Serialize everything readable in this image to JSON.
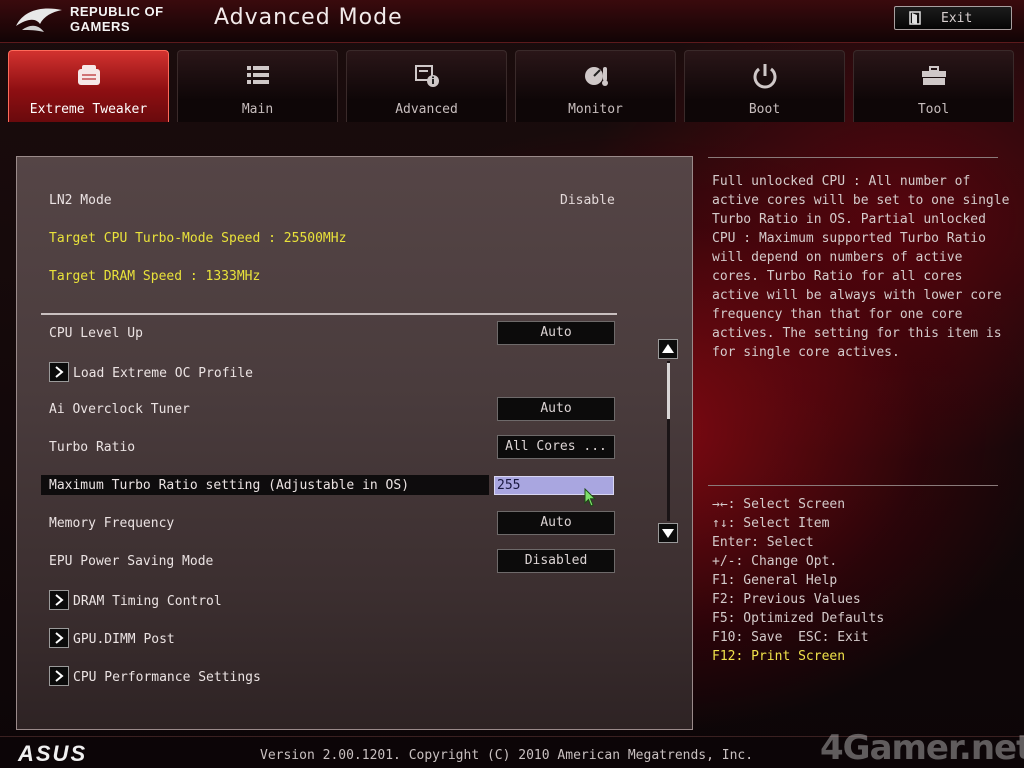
{
  "header": {
    "brand_line1": "REPUBLIC OF",
    "brand_line2": "GAMERS",
    "title": "Advanced Mode",
    "exit_label": "Exit"
  },
  "tabs": [
    {
      "label": "Extreme Tweaker",
      "icon": "tweaker-icon",
      "active": true
    },
    {
      "label": "Main",
      "icon": "list-icon",
      "active": false
    },
    {
      "label": "Advanced",
      "icon": "advanced-icon",
      "active": false
    },
    {
      "label": "Monitor",
      "icon": "monitor-gauge-icon",
      "active": false
    },
    {
      "label": "Boot",
      "icon": "power-icon",
      "active": false
    },
    {
      "label": "Tool",
      "icon": "toolbox-icon",
      "active": false
    }
  ],
  "main": {
    "ln2_label": "LN2 Mode",
    "ln2_value": "Disable",
    "target_cpu": "Target CPU Turbo-Mode Speed : 25500MHz",
    "target_dram": "Target DRAM Speed : 1333MHz",
    "settings": {
      "cpu_level_up": {
        "label": "CPU Level Up",
        "value": "Auto"
      },
      "load_extreme_oc": {
        "label": "Load Extreme OC Profile"
      },
      "ai_overclock": {
        "label": "Ai Overclock Tuner",
        "value": "Auto"
      },
      "turbo_ratio": {
        "label": "Turbo Ratio",
        "value": "All Cores ..."
      },
      "max_turbo": {
        "label": "Maximum Turbo Ratio setting (Adjustable in OS)",
        "value": "255"
      },
      "memory_freq": {
        "label": "Memory Frequency",
        "value": "Auto"
      },
      "epu": {
        "label": "EPU Power Saving Mode",
        "value": "Disabled"
      },
      "dram_timing": {
        "label": "DRAM Timing Control"
      },
      "gpu_dimm": {
        "label": "GPU.DIMM Post"
      },
      "cpu_perf": {
        "label": "CPU Performance Settings"
      }
    }
  },
  "help": {
    "description": "Full unlocked CPU : All number of active cores will be set to one single Turbo Ratio in OS. Partial unlocked CPU : Maximum supported Turbo Ratio will depend on numbers of active cores. Turbo Ratio for all cores active will be always with lower core frequency than that for one core actives. The setting for this item is for single core actives.",
    "keys": [
      "→←: Select Screen",
      "↑↓: Select Item",
      "Enter: Select",
      "+/-: Change Opt.",
      "F1: General Help",
      "F2: Previous Values",
      "F5: Optimized Defaults",
      "F10: Save  ESC: Exit",
      "F12: Print Screen"
    ]
  },
  "footer": {
    "asus": "ASUS",
    "version": "Version 2.00.1201. Copyright (C) 2010 American Megatrends, Inc.",
    "watermark": "4Gamer.net"
  },
  "colors": {
    "accent_red": "#d2322f",
    "highlight_yellow": "#e9e23a",
    "input_selected": "#a9a6e0"
  }
}
